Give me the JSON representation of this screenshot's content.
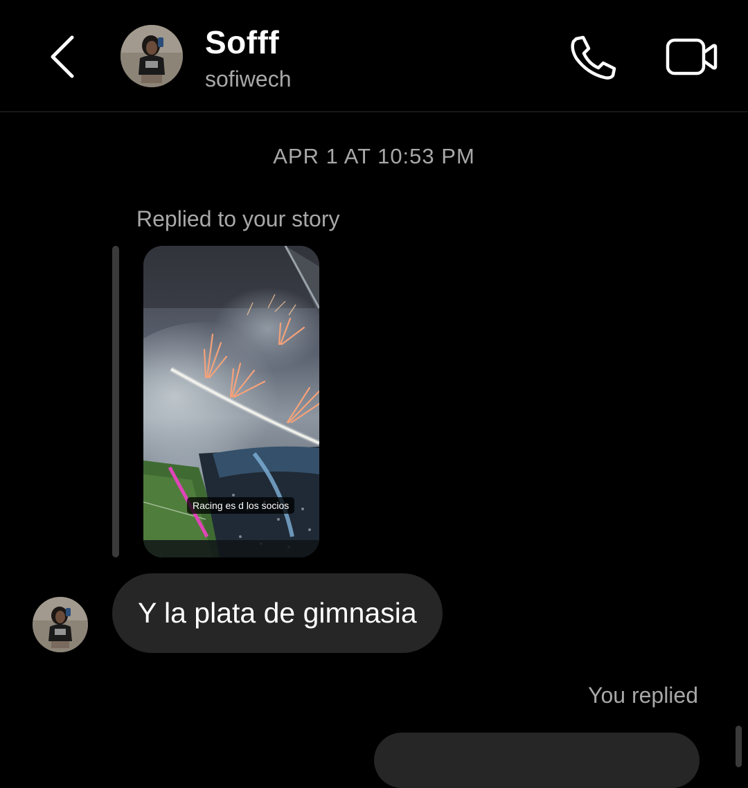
{
  "header": {
    "contact_name": "Sofff",
    "contact_handle": "sofiwech",
    "back_icon": "chevron-left-icon",
    "call_icon": "phone-icon",
    "video_icon": "video-camera-icon"
  },
  "thread": {
    "timestamp": "APR 1 AT 10:53 PM",
    "story_reply": {
      "label": "Replied to your story",
      "story_caption": "Racing es d los socios"
    },
    "incoming_message": "Y la plata de gimnasia",
    "outgoing_label": "You replied"
  },
  "colors": {
    "background": "#000000",
    "bubble": "#262626",
    "secondary_text": "#a8a8a8",
    "primary_text": "#ffffff"
  }
}
